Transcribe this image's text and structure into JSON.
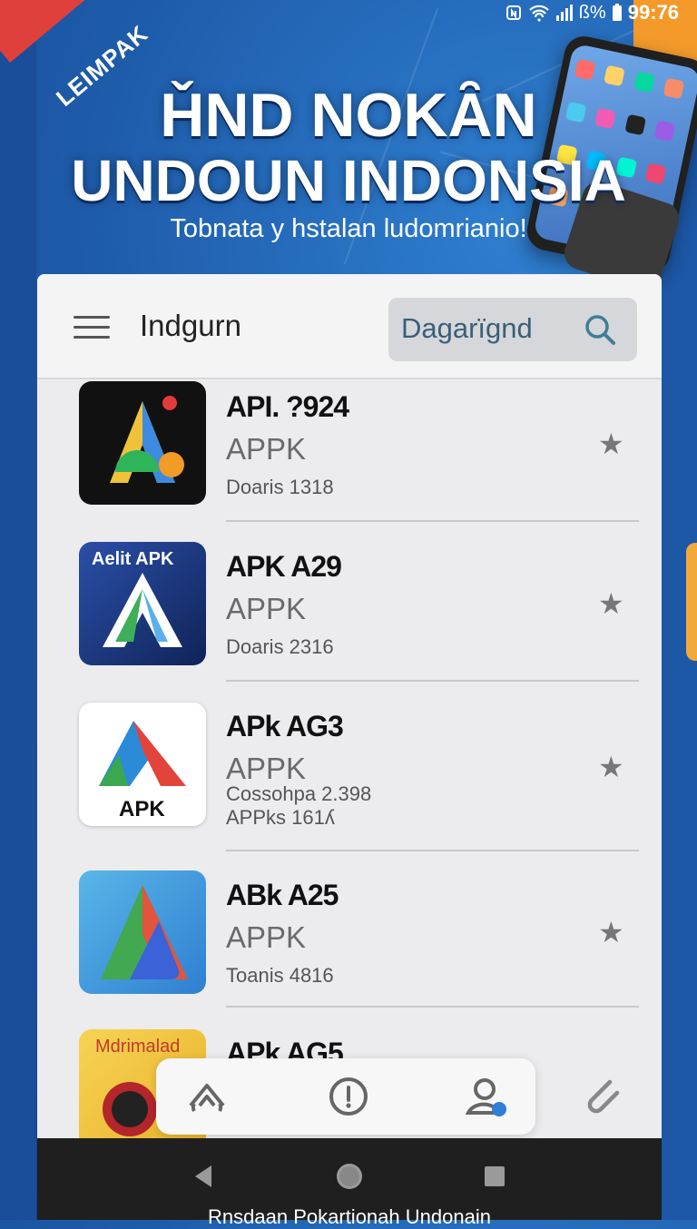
{
  "status": {
    "time": "99:76",
    "signal_text": "ß%"
  },
  "ribbon": {
    "label": "LEIMPAK"
  },
  "hero": {
    "title_line1": "ȞND NOKȂN",
    "title_line2": "UNDOUN INDONSIA",
    "subtitle": "Tobnata y hstalan ludomrianio!"
  },
  "appbar": {
    "title": "Indgurn",
    "search_text": "Dagarïgnd"
  },
  "apps": [
    {
      "name": "API. ?924",
      "kind": "APPK",
      "meta1": "Doaris 1318",
      "meta2": "",
      "icon_label": ""
    },
    {
      "name": "APK A29",
      "kind": "APPK",
      "meta1": "Doaris 2316",
      "meta2": "",
      "icon_label": "Aelit APK"
    },
    {
      "name": "APk AG3",
      "kind": "APPK",
      "meta1": "Cossohpa 2.398",
      "meta2": "APPks 161ʎ",
      "icon_label": "APK"
    },
    {
      "name": "ABk A25",
      "kind": "APPK",
      "meta1": "Toanis 4816",
      "meta2": "",
      "icon_label": ""
    },
    {
      "name": "APk AG5",
      "kind": "",
      "meta1": "",
      "meta2": "",
      "icon_label": "Mdrimalad"
    }
  ],
  "footer": {
    "text": "Rnsdaan Pokartionah Undonain"
  },
  "colors": {
    "accent": "#e0403b",
    "background": "#1d5aa8",
    "orange": "#f39a2b"
  }
}
